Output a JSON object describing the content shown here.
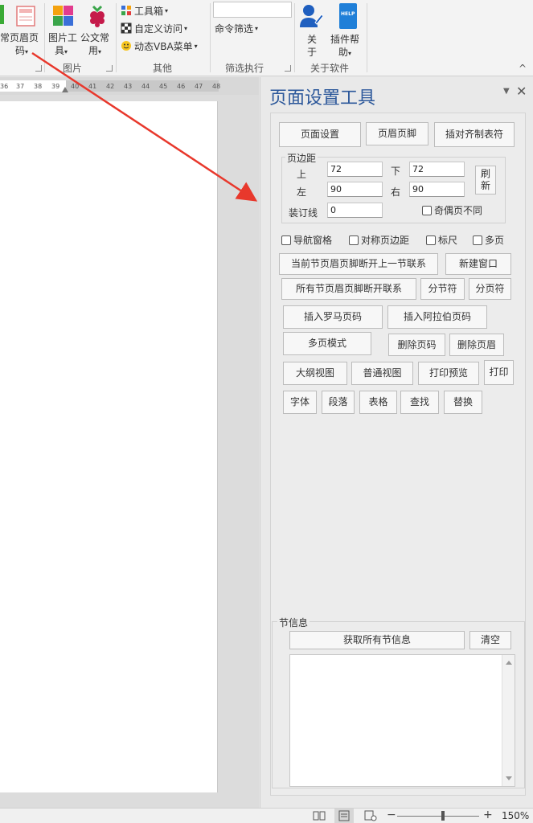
{
  "ribbon": {
    "btn_partial": "常",
    "btn_header_page": {
      "line1": "页眉页",
      "line2": "码"
    },
    "btn_image_tools": {
      "line1": "图片工",
      "line2": "具"
    },
    "btn_official": {
      "line1": "公文常",
      "line2": "用"
    },
    "toolbox": "工具箱",
    "custom_access": "自定义访问",
    "dynamic_vba": "动态VBA菜单",
    "command_filter": "命令筛选",
    "btn_about": {
      "line1": "关",
      "line2": "于"
    },
    "btn_plugin_help": {
      "line1": "插件帮",
      "line2": "助"
    },
    "help_badge": "HELP",
    "groups": {
      "image": "图片",
      "other": "其他",
      "filter": "筛选执行",
      "about": "关于软件"
    },
    "dropdown_glyph": "▾",
    "collapse_glyph": "^"
  },
  "ruler": [
    "36",
    "37",
    "38",
    "39",
    "40",
    "41",
    "42",
    "43",
    "44",
    "45",
    "46",
    "47",
    "48"
  ],
  "panel": {
    "title": "页面设置工具",
    "menu_glyph": "▼",
    "close_glyph": "✕",
    "btn_page_setup": "页面设置",
    "btn_header_footer": "页眉页脚",
    "btn_insert_tab": "插对齐制表符",
    "margins": {
      "legend": "页边距",
      "top_label": "上",
      "top_value": "72",
      "bottom_label": "下",
      "bottom_value": "72",
      "left_label": "左",
      "left_value": "90",
      "right_label": "右",
      "right_value": "90",
      "gutter_label": "装订线",
      "gutter_value": "0",
      "refresh": {
        "line1": "刷",
        "line2": "新"
      },
      "odd_even": "奇偶页不同"
    },
    "checkboxes": {
      "nav": "导航窗格",
      "mirror": "对称页边距",
      "ruler": "标尺",
      "multipage": "多页"
    },
    "btn_break_prev": "当前节页眉页脚断开上一节联系",
    "btn_new_window": "新建窗口",
    "btn_break_all": "所有节页眉页脚断开联系",
    "btn_section_break": "分节符",
    "btn_page_break": "分页符",
    "btn_roman": "插入罗马页码",
    "btn_arabic": "插入阿拉伯页码",
    "btn_multi_page": "多页模式",
    "btn_del_page_num": "删除页码",
    "btn_del_header": "删除页眉",
    "btn_outline": "大纲视图",
    "btn_normal": "普通视图",
    "btn_preview": "打印预览",
    "btn_print": "打印",
    "btn_font": "字体",
    "btn_paragraph": "段落",
    "btn_table": "表格",
    "btn_find": "查找",
    "btn_replace": "替换",
    "section_info": {
      "legend": "节信息",
      "btn_get_all": "获取所有节信息",
      "btn_clear": "清空"
    }
  },
  "status": {
    "minus": "−",
    "plus": "+",
    "zoom": "150%"
  },
  "colors": {
    "accent": "#2b579a",
    "arrow": "#e8382c"
  }
}
